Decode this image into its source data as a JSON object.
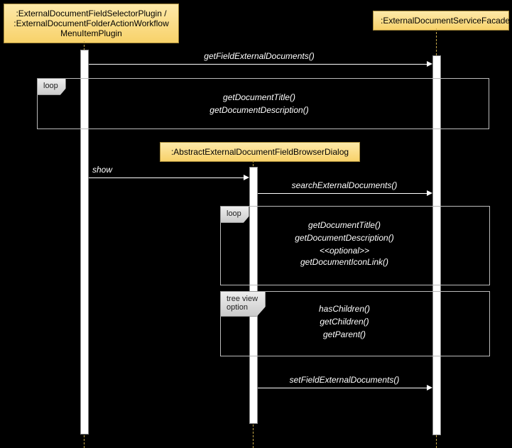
{
  "participants": {
    "plugin": ":ExternalDocumentFieldSelectorPlugin /\n:ExternalDocumentFolderActionWorkflow\nMenuItemPlugin",
    "facade": ":ExternalDocumentServiceFacade",
    "dialog": ":AbstractExternalDocumentFieldBrowserDialog"
  },
  "messages": {
    "m1": "getFieldExternalDocuments()",
    "m2": "getDocumentTitle()",
    "m3": "getDocumentDescription()",
    "show": "show",
    "m4": "searchExternalDocuments()",
    "m5": "getDocumentTitle()",
    "m6": "getDocumentDescription()",
    "m7opt": "<<optional>>",
    "m7": "getDocumentIconLink()",
    "m8": "hasChildren()",
    "m9": "getChildren()",
    "m10": "getParent()",
    "m11": "setFieldExternalDocuments()"
  },
  "fragments": {
    "loop1": "loop",
    "loop2": "loop",
    "treeview": "tree view\noption"
  },
  "chart_data": {
    "type": "sequence-diagram",
    "participants": [
      "ExternalDocumentFieldSelectorPlugin / ExternalDocumentFolderActionWorkflowMenuItemPlugin",
      "AbstractExternalDocumentFieldBrowserDialog",
      "ExternalDocumentServiceFacade"
    ],
    "interactions": [
      {
        "from": "Plugin",
        "to": "Facade",
        "message": "getFieldExternalDocuments()"
      },
      {
        "fragment": "loop",
        "messages": [
          {
            "from": "Plugin",
            "to": "Facade",
            "message": "getDocumentTitle()"
          },
          {
            "from": "Plugin",
            "to": "Facade",
            "message": "getDocumentDescription()"
          }
        ]
      },
      {
        "from": "Plugin",
        "to": "Dialog",
        "message": "show"
      },
      {
        "from": "Dialog",
        "to": "Facade",
        "message": "searchExternalDocuments()"
      },
      {
        "fragment": "loop",
        "messages": [
          {
            "from": "Dialog",
            "to": "Facade",
            "message": "getDocumentTitle()"
          },
          {
            "from": "Dialog",
            "to": "Facade",
            "message": "getDocumentDescription()"
          },
          {
            "from": "Dialog",
            "to": "Facade",
            "message": "getDocumentIconLink()",
            "note": "optional"
          }
        ]
      },
      {
        "fragment": "tree view option",
        "messages": [
          {
            "from": "Dialog",
            "to": "Facade",
            "message": "hasChildren()"
          },
          {
            "from": "Dialog",
            "to": "Facade",
            "message": "getChildren()"
          },
          {
            "from": "Dialog",
            "to": "Facade",
            "message": "getParent()"
          }
        ]
      },
      {
        "from": "Dialog",
        "to": "Facade",
        "message": "setFieldExternalDocuments()"
      }
    ]
  }
}
